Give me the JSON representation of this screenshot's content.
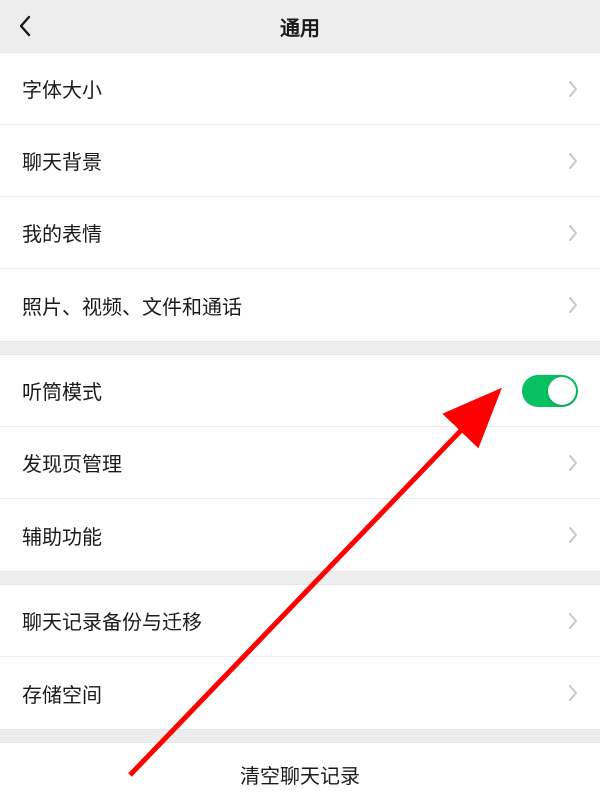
{
  "header": {
    "title": "通用"
  },
  "groups": [
    {
      "items": [
        {
          "label": "字体大小",
          "type": "nav"
        },
        {
          "label": "聊天背景",
          "type": "nav"
        },
        {
          "label": "我的表情",
          "type": "nav"
        },
        {
          "label": "照片、视频、文件和通话",
          "type": "nav"
        }
      ]
    },
    {
      "items": [
        {
          "label": "听筒模式",
          "type": "toggle",
          "on": true
        },
        {
          "label": "发现页管理",
          "type": "nav"
        },
        {
          "label": "辅助功能",
          "type": "nav"
        }
      ]
    },
    {
      "items": [
        {
          "label": "聊天记录备份与迁移",
          "type": "nav"
        },
        {
          "label": "存储空间",
          "type": "nav"
        }
      ]
    }
  ],
  "footer": {
    "clear_label": "清空聊天记录"
  },
  "annotation": {
    "arrow_color": "#ff0000"
  }
}
